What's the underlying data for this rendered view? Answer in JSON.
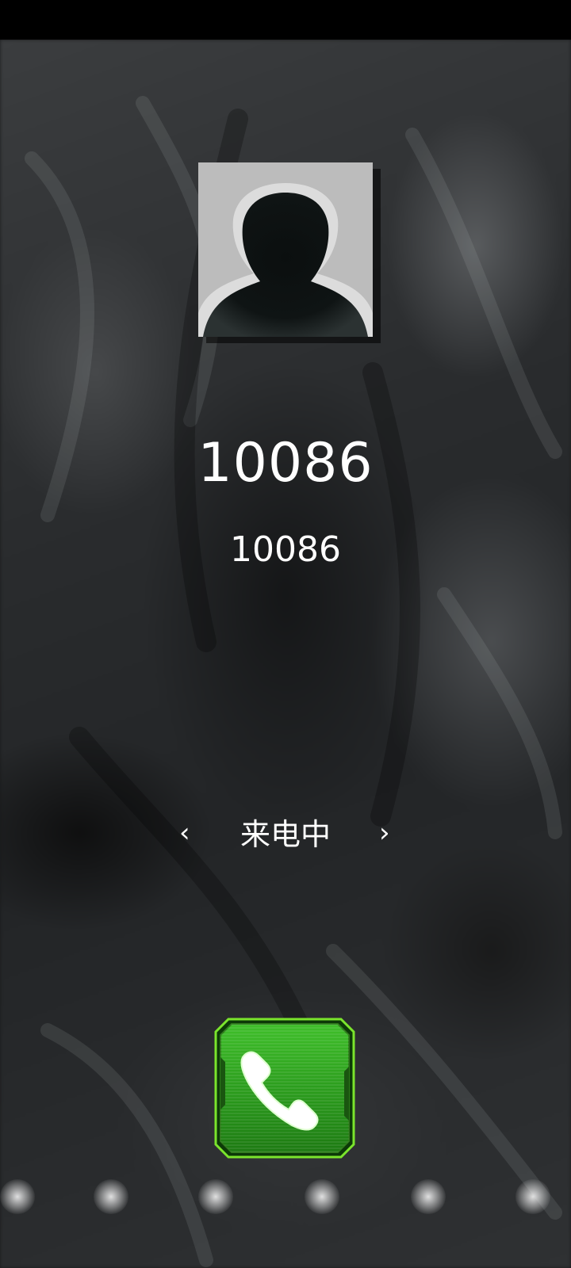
{
  "caller": {
    "name": "10086",
    "number": "10086"
  },
  "call": {
    "status": "来电中",
    "left_hint": "‹",
    "right_hint": "›"
  },
  "icons": {
    "avatar": "person-silhouette-icon",
    "answer": "phone-icon"
  },
  "colors": {
    "answer_green": "#2aa01c",
    "answer_border": "#7be52c",
    "text": "#ffffff"
  }
}
